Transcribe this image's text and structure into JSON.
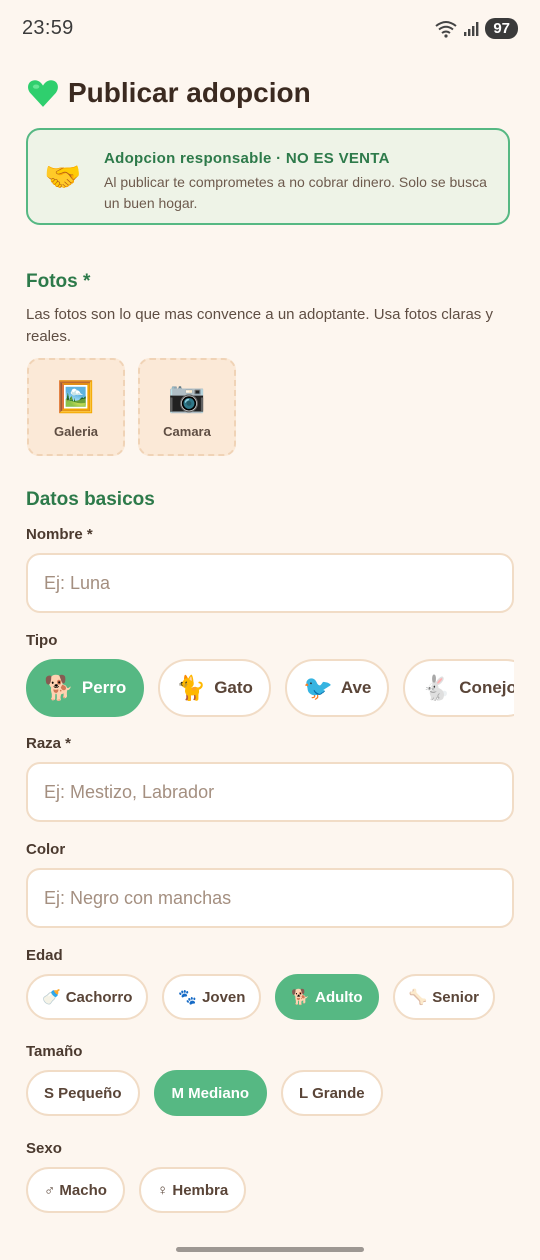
{
  "status": {
    "time": "23:59",
    "battery": "97"
  },
  "page": {
    "icon": "green-heart-icon",
    "title": "Publicar adopcion"
  },
  "notice": {
    "icon": "handshake-icon",
    "title": "Adopcion responsable · NO ES VENTA",
    "text": "Al publicar te comprometes a no cobrar dinero. Solo se busca un buen hogar."
  },
  "photos": {
    "title": "Fotos *",
    "desc": "Las fotos son lo que mas convence a un adoptante. Usa fotos claras y reales.",
    "buttons": [
      {
        "icon": "gallery-icon",
        "label": "Galeria"
      },
      {
        "icon": "camera-icon",
        "label": "Camara"
      }
    ]
  },
  "basics": {
    "title": "Datos basicos",
    "nombre": {
      "label": "Nombre *",
      "placeholder": "Ej: Luna"
    },
    "tipo": {
      "label": "Tipo",
      "options": [
        {
          "icon": "🐕",
          "label": "Perro",
          "selected": true
        },
        {
          "icon": "🐈",
          "label": "Gato",
          "selected": false
        },
        {
          "icon": "🐦",
          "label": "Ave",
          "selected": false
        },
        {
          "icon": "🐇",
          "label": "Conejo",
          "selected": false
        }
      ]
    },
    "raza": {
      "label": "Raza *",
      "placeholder": "Ej: Mestizo, Labrador"
    },
    "color": {
      "label": "Color",
      "placeholder": "Ej: Negro con manchas"
    },
    "edad": {
      "label": "Edad",
      "options": [
        {
          "icon": "🍼",
          "label": "Cachorro",
          "selected": false
        },
        {
          "icon": "🐾",
          "label": "Joven",
          "selected": false
        },
        {
          "icon": "🐕",
          "label": "Adulto",
          "selected": true
        },
        {
          "icon": "🦴",
          "label": "Senior",
          "selected": false
        }
      ]
    },
    "tamano": {
      "label": "Tamaño",
      "options": [
        {
          "label": "S Pequeño",
          "selected": false
        },
        {
          "label": "M Mediano",
          "selected": true
        },
        {
          "label": "L Grande",
          "selected": false
        }
      ]
    },
    "sexo": {
      "label": "Sexo",
      "options": [
        {
          "label": "♂ Macho",
          "selected": false
        },
        {
          "label": "♀ Hembra",
          "selected": false
        }
      ]
    }
  },
  "colors": {
    "accent": "#56b883",
    "heading": "#2d7a4a",
    "background": "#fdf6ef",
    "border": "#f1dcc6"
  }
}
